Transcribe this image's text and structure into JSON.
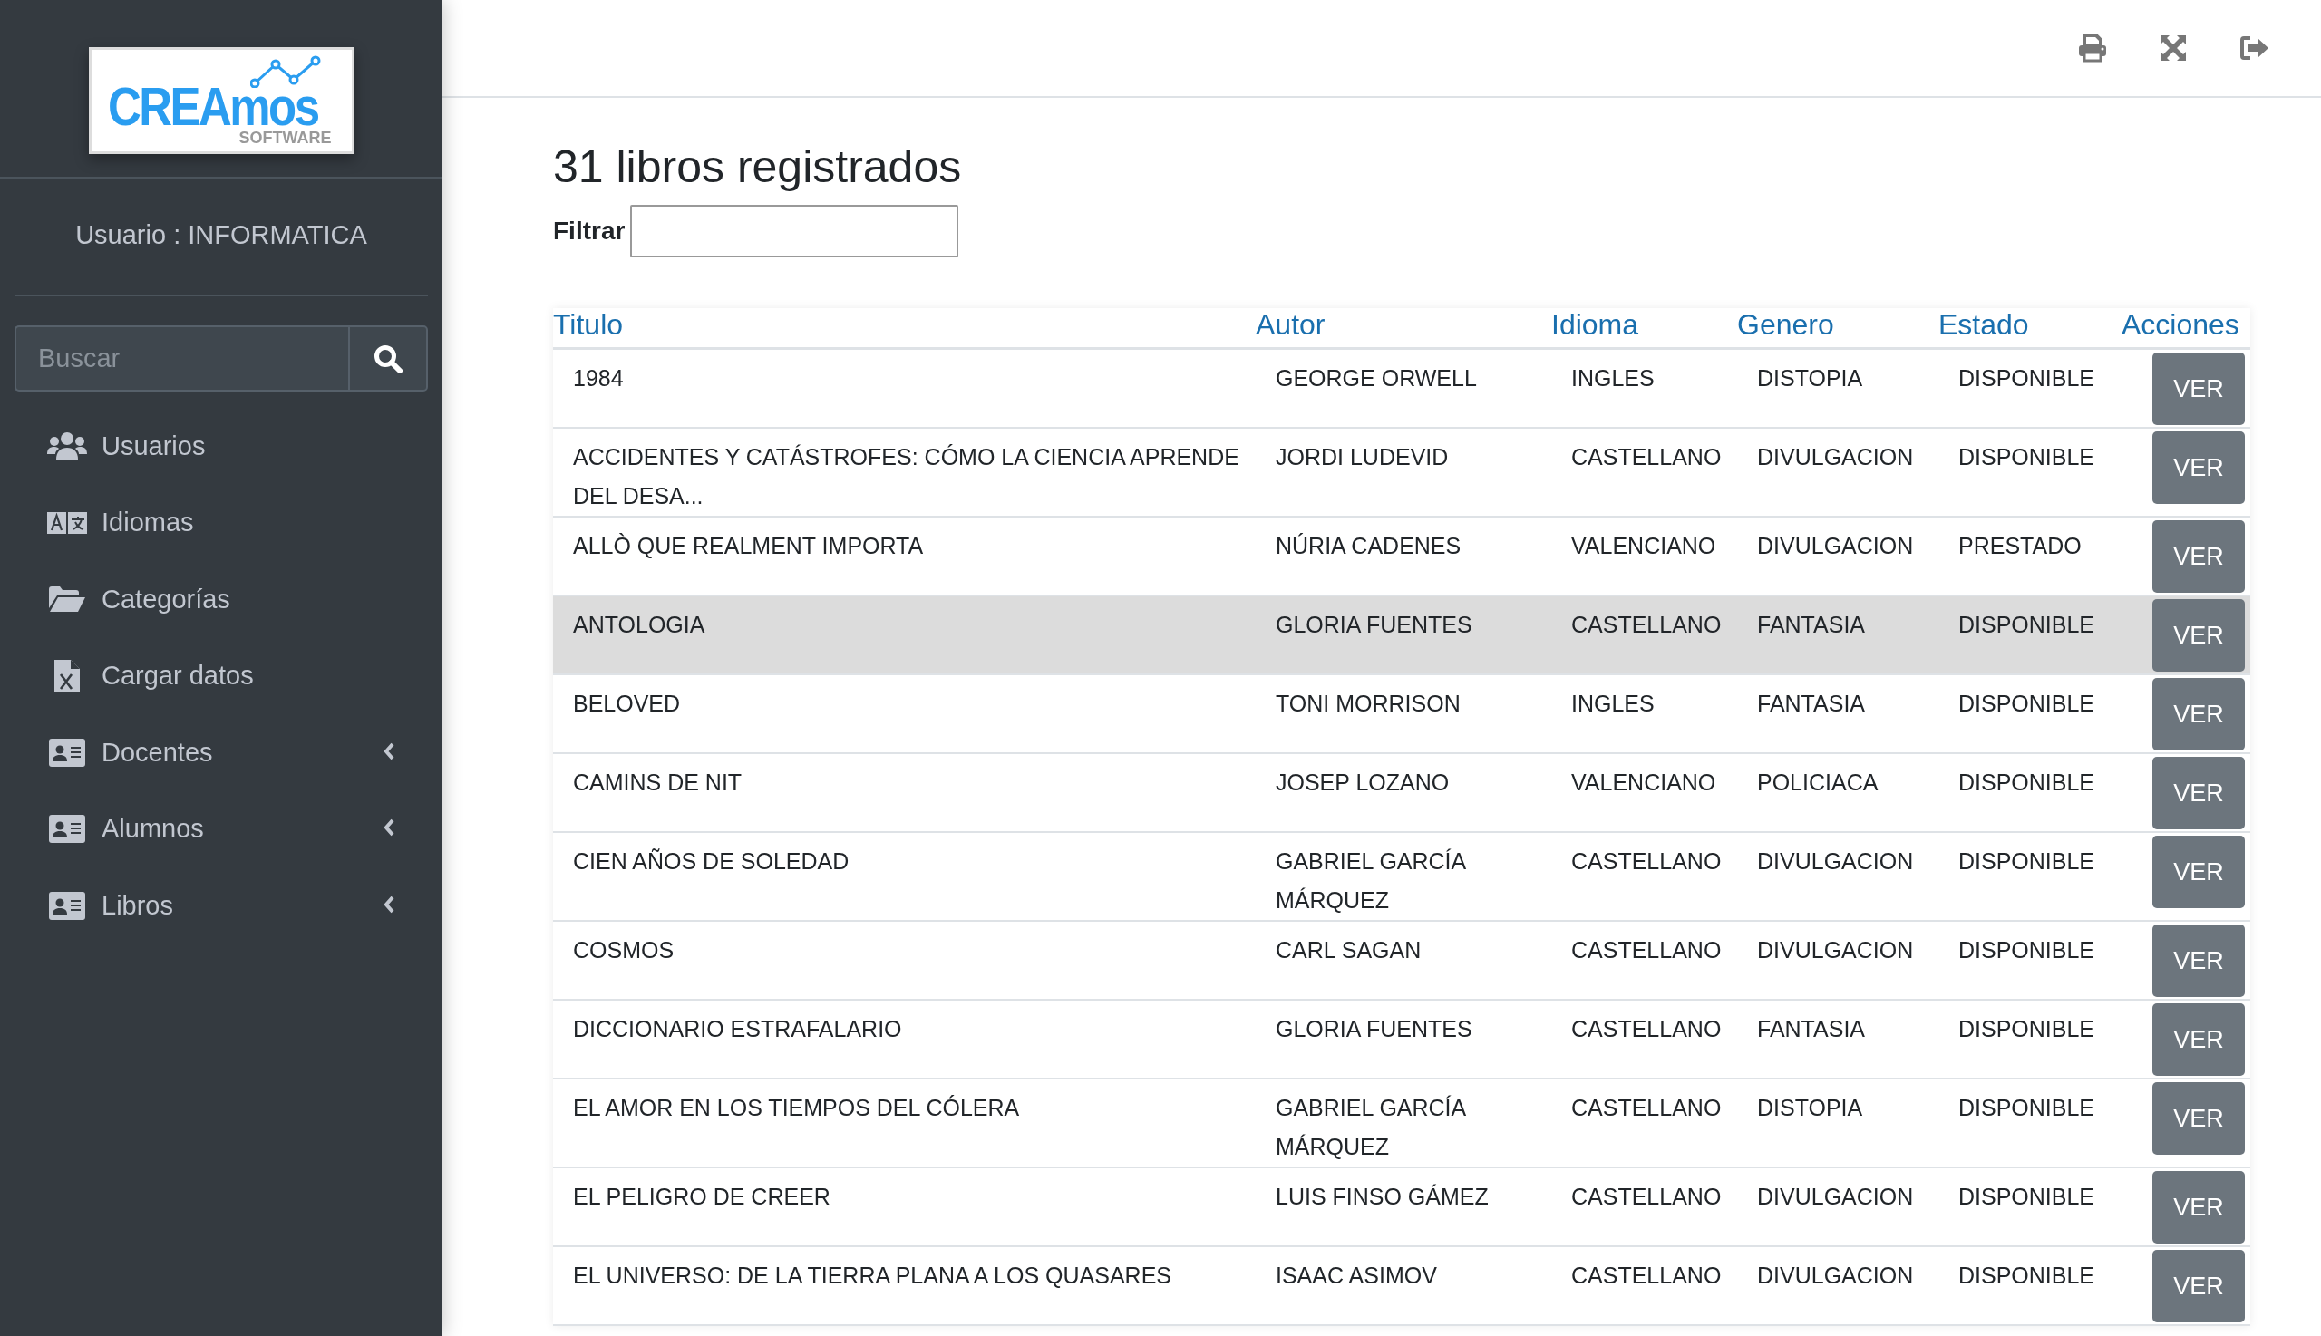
{
  "sidebar": {
    "logo": {
      "name": "CREAmos",
      "subtitle": "SOFTWARE"
    },
    "user": "Usuario : INFORMATICA",
    "search": {
      "placeholder": "Buscar"
    },
    "items": [
      {
        "label": "Usuarios",
        "kind": "users",
        "expandable": false
      },
      {
        "label": "Idiomas",
        "kind": "language",
        "expandable": false
      },
      {
        "label": "Categorías",
        "kind": "folder",
        "expandable": false
      },
      {
        "label": "Cargar datos",
        "kind": "excel",
        "expandable": false
      },
      {
        "label": "Docentes",
        "kind": "idcard",
        "expandable": true
      },
      {
        "label": "Alumnos",
        "kind": "idcard",
        "expandable": true
      },
      {
        "label": "Libros",
        "kind": "idcard",
        "expandable": true
      }
    ]
  },
  "toolbar": [
    {
      "kind": "print"
    },
    {
      "kind": "expand"
    },
    {
      "kind": "logout"
    }
  ],
  "page": {
    "title": "31 libros registrados",
    "filter": {
      "label": "Filtrar"
    }
  },
  "table": {
    "columns": [
      "Titulo",
      "Autor",
      "Idioma",
      "Genero",
      "Estado",
      "Acciones"
    ],
    "rows": [
      {
        "titulo": "1984",
        "autor": "GEORGE ORWELL",
        "idioma": "INGLES",
        "genero": "DISTOPIA",
        "estado": "DISPONIBLE",
        "action": "VER",
        "highlighted": false
      },
      {
        "titulo": "ACCIDENTES Y CATÁSTROFES: CÓMO LA CIENCIA APRENDE DEL DESA...",
        "autor": "JORDI LUDEVID",
        "idioma": "CASTELLANO",
        "genero": "DIVULGACION",
        "estado": "DISPONIBLE",
        "action": "VER",
        "highlighted": false
      },
      {
        "titulo": "ALLÒ QUE REALMENT IMPORTA",
        "autor": "NÚRIA CADENES",
        "idioma": "VALENCIANO",
        "genero": "DIVULGACION",
        "estado": "PRESTADO",
        "action": "VER",
        "highlighted": false
      },
      {
        "titulo": "ANTOLOGIA",
        "autor": "GLORIA FUENTES",
        "idioma": "CASTELLANO",
        "genero": "FANTASIA",
        "estado": "DISPONIBLE",
        "action": "VER",
        "highlighted": true
      },
      {
        "titulo": "BELOVED",
        "autor": "TONI MORRISON",
        "idioma": "INGLES",
        "genero": "FANTASIA",
        "estado": "DISPONIBLE",
        "action": "VER",
        "highlighted": false
      },
      {
        "titulo": "CAMINS DE NIT",
        "autor": "JOSEP LOZANO",
        "idioma": "VALENCIANO",
        "genero": "POLICIACA",
        "estado": "DISPONIBLE",
        "action": "VER",
        "highlighted": false
      },
      {
        "titulo": "CIEN AÑOS DE SOLEDAD",
        "autor": "GABRIEL GARCÍA MÁRQUEZ",
        "idioma": "CASTELLANO",
        "genero": "DIVULGACION",
        "estado": "DISPONIBLE",
        "action": "VER",
        "highlighted": false
      },
      {
        "titulo": "COSMOS",
        "autor": "CARL SAGAN",
        "idioma": "CASTELLANO",
        "genero": "DIVULGACION",
        "estado": "DISPONIBLE",
        "action": "VER",
        "highlighted": false
      },
      {
        "titulo": "DICCIONARIO ESTRAFALARIO",
        "autor": "GLORIA FUENTES",
        "idioma": "CASTELLANO",
        "genero": "FANTASIA",
        "estado": "DISPONIBLE",
        "action": "VER",
        "highlighted": false
      },
      {
        "titulo": "EL AMOR EN LOS TIEMPOS DEL CÓLERA",
        "autor": "GABRIEL GARCÍA MÁRQUEZ",
        "idioma": "CASTELLANO",
        "genero": "DISTOPIA",
        "estado": "DISPONIBLE",
        "action": "VER",
        "highlighted": false
      },
      {
        "titulo": "EL PELIGRO DE CREER",
        "autor": "LUIS FINSO GÁMEZ",
        "idioma": "CASTELLANO",
        "genero": "DIVULGACION",
        "estado": "DISPONIBLE",
        "action": "VER",
        "highlighted": false
      },
      {
        "titulo": "EL UNIVERSO: DE LA TIERRA PLANA A LOS QUASARES",
        "autor": "ISAAC ASIMOV",
        "idioma": "CASTELLANO",
        "genero": "DIVULGACION",
        "estado": "DISPONIBLE",
        "action": "VER",
        "highlighted": false
      }
    ]
  }
}
